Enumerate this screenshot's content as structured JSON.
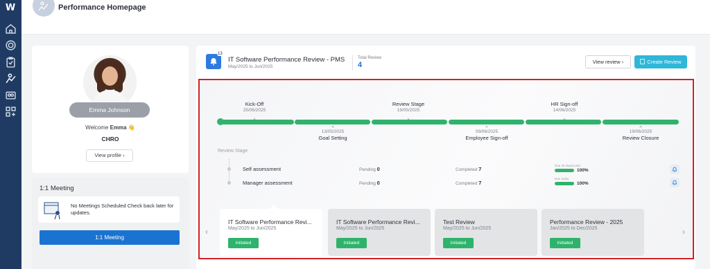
{
  "nav": {
    "logo": "W",
    "items": [
      "home-icon",
      "target-icon",
      "clipboard-icon",
      "performance-icon",
      "users-icon",
      "apps-icon"
    ]
  },
  "header": {
    "title": "Performance Homepage"
  },
  "profile": {
    "name": "Emma Johnson",
    "welcome_prefix": "Welcome",
    "welcome_name": "Emma",
    "wave": "👋",
    "role": "CHRO",
    "view_profile": "View profile",
    "chevron": "›"
  },
  "meeting": {
    "title": "1:1 Meeting",
    "empty_text": "No Meetings Scheduled Check back later for updates.",
    "button": "1:1 Meeting"
  },
  "review": {
    "bell_count": "13",
    "title": "IT Software Performance Review - PMS",
    "dates": "May/2025 to Jun/2025",
    "total_label": "Total Review",
    "total_value": "4",
    "view_button": "View review",
    "view_chevron": "›",
    "create_button": "Create Review",
    "accent": "#1a73d1",
    "success": "#2fb36c"
  },
  "timeline": {
    "top": [
      {
        "label": "Kick-Off",
        "date": "25/06/2025"
      },
      {
        "label": "Review Stage",
        "date": "19/05/2025"
      },
      {
        "label": "HR Sign-off",
        "date": "14/06/2025"
      }
    ],
    "bottom": [
      {
        "label": "Goal Setting",
        "date": "13/05/2025"
      },
      {
        "label": "Employee Sign-off",
        "date": "09/06/2025"
      },
      {
        "label": "Review Closure",
        "date": "19/06/2025"
      }
    ],
    "chev_down": "⌄",
    "chev_up": "^"
  },
  "stage": {
    "label": "Review Stage",
    "rows": [
      {
        "name": "Self assessment",
        "pending_label": "Pending",
        "pending": "0",
        "completed_label": "Completed",
        "completed": "7",
        "due": "Due 45 days(Late)",
        "percent": "100%"
      },
      {
        "name": "Manager assessment",
        "pending_label": "Pending",
        "pending": "0",
        "completed_label": "Completed",
        "completed": "7",
        "due": "Due today",
        "percent": "100%"
      }
    ]
  },
  "cards": {
    "prev": "‹",
    "next": "›",
    "items": [
      {
        "title": "IT Software Performance Revi...",
        "dates": "May/2025 to Jun/2025",
        "status": "Initiated"
      },
      {
        "title": "IT Software Performance Revi...",
        "dates": "May/2025 to Jun/2025",
        "status": "Initiated"
      },
      {
        "title": "Test Review",
        "dates": "May/2025 to Jun/2025",
        "status": "Initiated"
      },
      {
        "title": "Performance Review - 2025",
        "dates": "Jan/2025 to Dec/2025",
        "status": "Initiated"
      }
    ]
  }
}
